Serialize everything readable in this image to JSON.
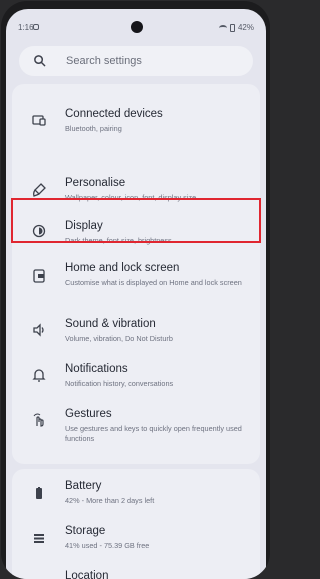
{
  "status": {
    "time": "1:16",
    "battery": "42%"
  },
  "search": {
    "placeholder": "Search settings"
  },
  "items": [
    {
      "title": "Connected devices",
      "subtitle": "Bluetooth, pairing"
    },
    {
      "title": "Personalise",
      "subtitle": "Wallpaper, colour, icon, font, display size"
    },
    {
      "title": "Display",
      "subtitle": "Dark theme, font size, brightness"
    },
    {
      "title": "Home and lock screen",
      "subtitle": "Customise what is displayed on Home and lock screen"
    },
    {
      "title": "Sound & vibration",
      "subtitle": "Volume, vibration, Do Not Disturb"
    },
    {
      "title": "Notifications",
      "subtitle": "Notification history, conversations"
    },
    {
      "title": "Gestures",
      "subtitle": "Use gestures and keys to quickly open frequently used functions"
    },
    {
      "title": "Battery",
      "subtitle": "42% - More than 2 days left"
    },
    {
      "title": "Storage",
      "subtitle": "41% used - 75.39 GB free"
    },
    {
      "title": "Location",
      "subtitle": ""
    }
  ],
  "colors": {
    "highlight": "#e02630",
    "screen_bg": "#e4e5ee"
  }
}
